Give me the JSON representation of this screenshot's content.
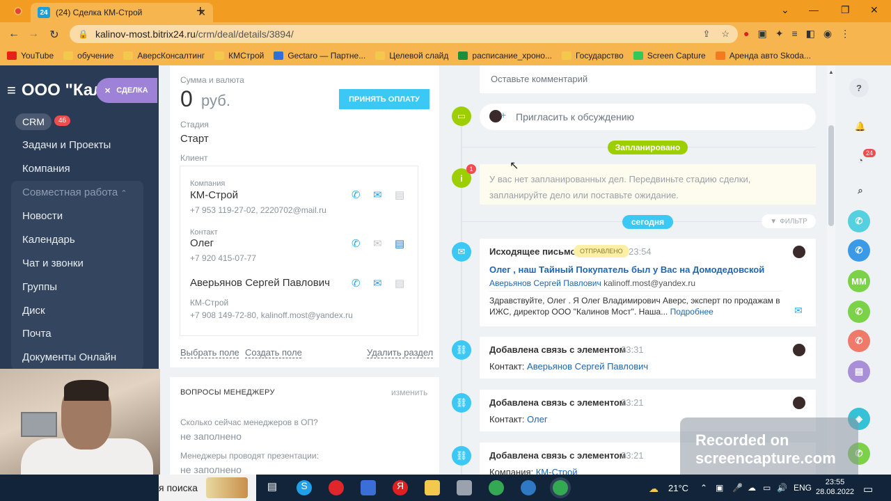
{
  "browser": {
    "tab_title": "(24) Сделка КМ-Строй",
    "tab_favicon_text": "24",
    "url_host": "kalinov-most.bitrix24.ru",
    "url_path": "/crm/deal/details/3894/",
    "bookmarks": [
      {
        "label": "YouTube",
        "color": "#e62117"
      },
      {
        "label": "обучение",
        "color": "#f2c94c"
      },
      {
        "label": "АверсКонсалтинг",
        "color": "#f2c94c"
      },
      {
        "label": "КМСтрой",
        "color": "#f2c94c"
      },
      {
        "label": "Gectaro — Партне...",
        "color": "#2f6fd6"
      },
      {
        "label": "Целевой слайд",
        "color": "#f2c94c"
      },
      {
        "label": "расписание_хроно...",
        "color": "#1e8e3e"
      },
      {
        "label": "Государство",
        "color": "#f2c94c"
      },
      {
        "label": "Screen Capture",
        "color": "#34c759"
      },
      {
        "label": "Аренда авто Skoda...",
        "color": "#f27b21"
      }
    ]
  },
  "sidebar": {
    "portal_title": "ООО \"Кал",
    "deal_pill": "СДЕЛКА",
    "crm_label": "CRM",
    "crm_badge": "46",
    "items": [
      "Задачи и Проекты",
      "Компания",
      "Совместная работа",
      "Новости",
      "Календарь",
      "Чат и звонки",
      "Группы",
      "Диск",
      "Почта",
      "Документы Онлайн"
    ]
  },
  "deal": {
    "sum_label": "Сумма и валюта",
    "sum_value": "0",
    "sum_currency": "руб.",
    "accept_payment": "ПРИНЯТЬ ОПЛАТУ",
    "stage_label": "Стадия",
    "stage_value": "Старт",
    "client_label": "Клиент",
    "company_label": "Компания",
    "company_name": "КМ-Строй",
    "company_contacts": "+7 953 119-27-02, 2220702@mail.ru",
    "contact_label": "Контакт",
    "contact_name": "Олег",
    "contact_phone": "+7 920 415-07-77",
    "person_name": "Аверьянов Сергей Павлович",
    "person_company": "КМ-Строй",
    "person_contacts": "+7 908 149-72-80, kalinoff.most@yandex.ru",
    "select_field": "Выбрать поле",
    "create_field": "Создать поле",
    "delete_section": "Удалить раздел",
    "questions_header": "ВОПРОСЫ МЕНЕДЖЕРУ",
    "questions_edit": "изменить",
    "q1_label": "Сколько сейчас менеджеров в ОП?",
    "q1_value": "не заполнено",
    "q2_label": "Менеджеры проводят презентации:",
    "q2_value": "не заполнено"
  },
  "timeline": {
    "comment_placeholder": "Оставьте комментарий",
    "invite": "Пригласить к обсуждению",
    "planned_pill": "Запланировано",
    "info_badge": "1",
    "info_text": "У вас нет запланированных дел. Передвиньте стадию сделки, запланируйте дело или поставьте ожидание.",
    "today_pill": "сегодня",
    "filter": "ФИЛЬТР",
    "email": {
      "title": "Исходящее письмо",
      "status": "ОТПРАВЛЕНО",
      "time": "23:54",
      "subject": "Олег , наш Тайный Покупатель был у Вас на Домодедовской",
      "from_name": "Аверьянов Сергей Павлович",
      "from_email": "kalinoff.most@yandex.ru",
      "body": "Здравствуйте, Олег . Я Олег Владимирович Аверс, эксперт по продажам в ИЖС, директор ООО \"Калинов Мост\". Наша...",
      "more": "Подробнее"
    },
    "links": [
      {
        "title": "Добавлена связь с элементом",
        "time": "23:31",
        "kind": "Контакт:",
        "target": "Аверьянов Сергей Павлович"
      },
      {
        "title": "Добавлена связь с элементом",
        "time": "23:21",
        "kind": "Контакт:",
        "target": "Олег"
      },
      {
        "title": "Добавлена связь с элементом",
        "time": "23:21",
        "kind": "Компания:",
        "target": "КМ-Строй"
      }
    ]
  },
  "rightrail": {
    "chat_badge": "24",
    "mm_label": "ММ"
  },
  "watermark": {
    "line1": "Recorded on",
    "line2": "screencapture.com"
  },
  "taskbar": {
    "search_text": "я поиска",
    "temperature": "21°C",
    "lang": "ENG",
    "time": "23:55",
    "date": "28.08.2022"
  }
}
